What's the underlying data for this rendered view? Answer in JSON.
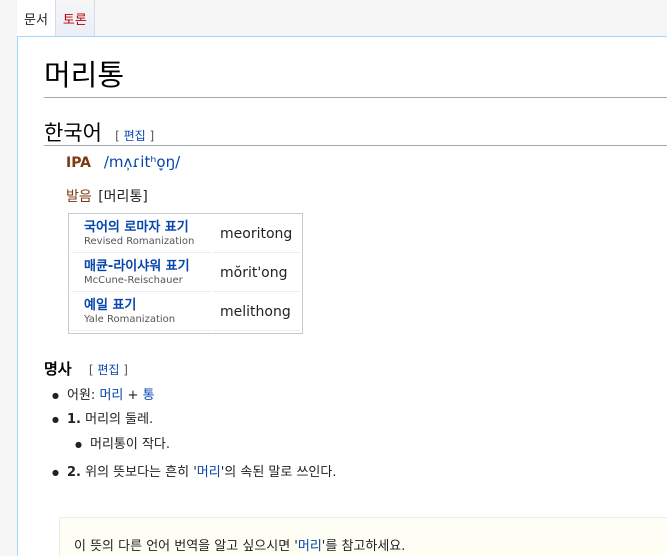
{
  "tabs": {
    "document": "문서",
    "talk": "토론"
  },
  "page_title": "머리통",
  "section": {
    "title": "한국어",
    "edit_open": "[",
    "edit_label": "편집",
    "edit_close": "]"
  },
  "ipa": {
    "label": "IPA",
    "value": "/mʌ̹ɾitʰo̞ŋ/"
  },
  "pronunciation": {
    "label": "발음",
    "value": "[머리통]"
  },
  "romanization": [
    {
      "ko": "국어의 로마자 표기",
      "en": "Revised Romanization",
      "value": "meoritong"
    },
    {
      "ko": "매큔-라이샤워 표기",
      "en": "McCune-Reischauer",
      "value": "mŏrit'ong"
    },
    {
      "ko": "예일 표기",
      "en": "Yale Romanization",
      "value": "melithong"
    }
  ],
  "noun": {
    "title": "명사",
    "edit_label": "편집"
  },
  "etymology": {
    "label": "어원:",
    "part1": "머리",
    "plus": "+",
    "part2": "통"
  },
  "sense1": {
    "num": "1.",
    "text": "머리의 둘레.",
    "example": "머리통이 작다."
  },
  "sense2": {
    "num": "2.",
    "pre": "위의 뜻보다는 흔히 '",
    "link": "머리",
    "post": "'의 속된 말로 쓰인다."
  },
  "note": {
    "pre": "이 뜻의 다른 언어 번역을 알고 싶으시면 '",
    "link": "머리",
    "post": "'를 참고하세요."
  }
}
